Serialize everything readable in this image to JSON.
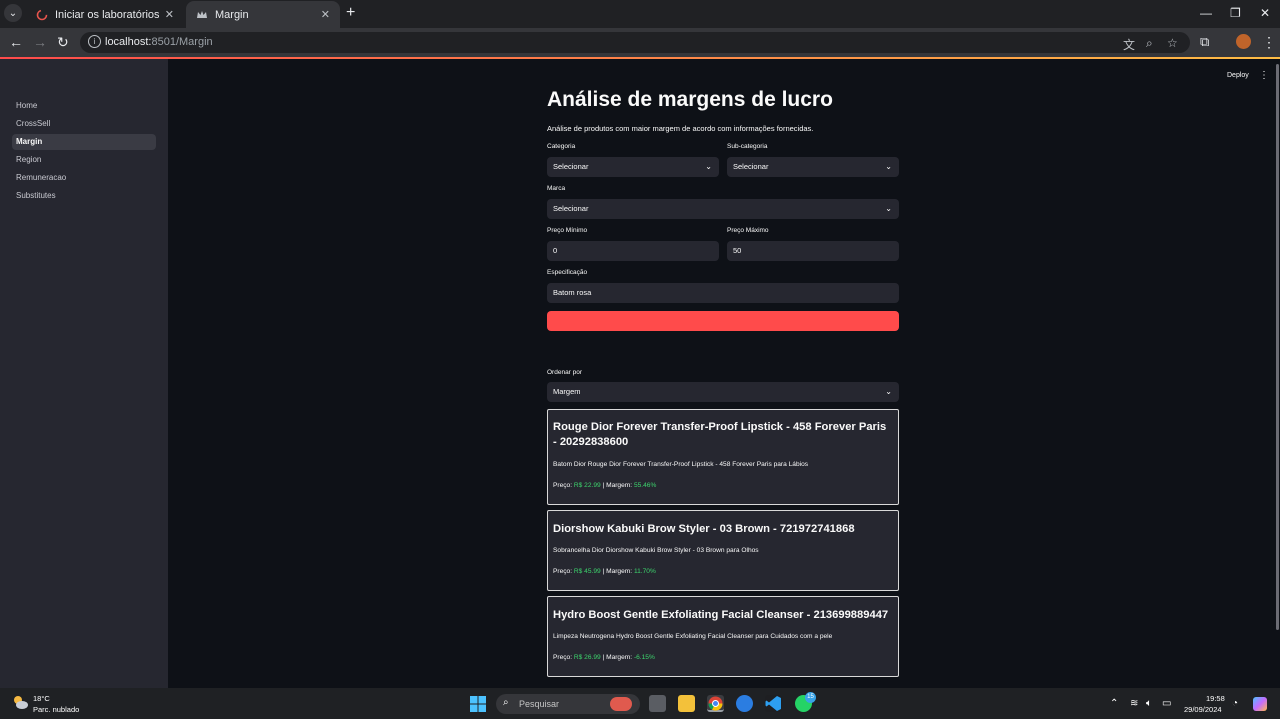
{
  "browser": {
    "tabs": [
      {
        "title": "Iniciar os laboratórios de aprer",
        "active": false
      },
      {
        "title": "Margin",
        "active": true
      }
    ],
    "url_host": "localhost:",
    "url_rest": "8501/Margin"
  },
  "sidebar": {
    "items": [
      {
        "label": "Home",
        "active": false
      },
      {
        "label": "CrossSell",
        "active": false
      },
      {
        "label": "Margin",
        "active": true
      },
      {
        "label": "Region",
        "active": false
      },
      {
        "label": "Remuneracao",
        "active": false
      },
      {
        "label": "Substitutes",
        "active": false
      }
    ]
  },
  "header": {
    "deploy_label": "Deploy"
  },
  "main": {
    "title": "Análise de margens de lucro",
    "description": "Análise de produtos com maior margem de acordo com informações fornecidas.",
    "form": {
      "categoria_label": "Categoria",
      "categoria_value": "Selecionar",
      "subcategoria_label": "Sub-categoria",
      "subcategoria_value": "Selecionar",
      "marca_label": "Marca",
      "marca_value": "Selecionar",
      "preco_min_label": "Preço Mínimo",
      "preco_min_value": "0",
      "preco_max_label": "Preço Máximo",
      "preco_max_value": "50",
      "especificacao_label": "Especificação",
      "especificacao_value": "Batom rosa"
    },
    "sort": {
      "label": "Ordenar por",
      "value": "Margem"
    },
    "products": [
      {
        "title": "Rouge Dior Forever Transfer-Proof Lipstick - 458 Forever Paris - 20292838600",
        "description": "Batom Dior Rouge Dior Forever Transfer-Proof Lipstick - 458 Forever Paris para Lábios",
        "price_label": "Preço:",
        "price": "R$ 22.99",
        "sep": "|",
        "margin_label": "Margem:",
        "margin": "55.46%"
      },
      {
        "title": "Diorshow Kabuki Brow Styler - 03 Brown - 721972741868",
        "description": "Sobrancelha Dior Diorshow Kabuki Brow Styler - 03 Brown para Olhos",
        "price_label": "Preço:",
        "price": "R$ 45.99",
        "sep": "|",
        "margin_label": "Margem:",
        "margin": "11.70%"
      },
      {
        "title": "Hydro Boost Gentle Exfoliating Facial Cleanser - 213699889447",
        "description": "Limpeza Neutrogena Hydro Boost Gentle Exfoliating Facial Cleanser para Cuidados com a pele",
        "price_label": "Preço:",
        "price": "R$ 26.99",
        "sep": "|",
        "margin_label": "Margem:",
        "margin": "-6.15%"
      }
    ]
  },
  "taskbar": {
    "weather_temp": "18°C",
    "weather_desc": "Parc. nublado",
    "search_placeholder": "Pesquisar",
    "whatsapp_badge": "15",
    "time": "19:58",
    "date": "29/09/2024"
  },
  "colors": {
    "accent": "#ff4b4b",
    "positive": "#3dd56d",
    "sidebar": "#262730",
    "background": "#0e1117"
  }
}
